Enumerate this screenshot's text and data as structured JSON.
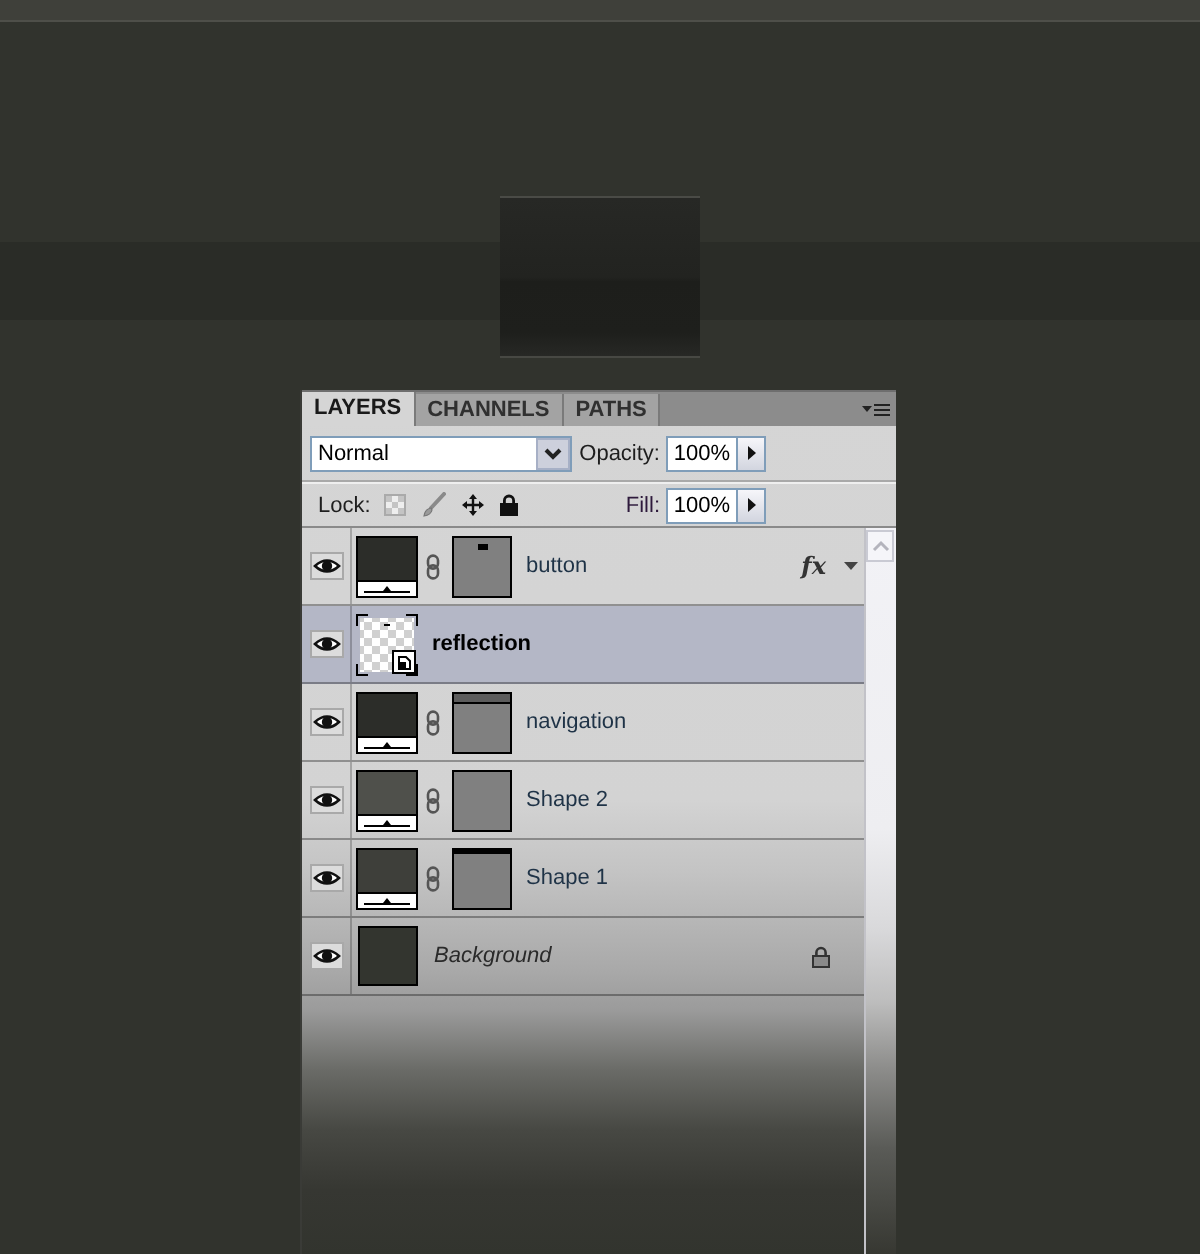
{
  "panel": {
    "tabs": [
      {
        "label": "LAYERS",
        "selected": true
      },
      {
        "label": "CHANNELS",
        "selected": false
      },
      {
        "label": "PATHS",
        "selected": false
      }
    ],
    "blend_mode": {
      "value": "Normal"
    },
    "opacity": {
      "label": "Opacity:",
      "value": "100%"
    },
    "lock": {
      "label": "Lock:"
    },
    "fill": {
      "label": "Fill:",
      "value": "100%"
    },
    "layers": [
      {
        "name": "button",
        "kind": "shape",
        "visible": true,
        "selected": false,
        "locked": false,
        "color": "#2c2d29",
        "mask": {
          "kind": "dot"
        },
        "effects": "fx"
      },
      {
        "name": "reflection",
        "kind": "smart",
        "visible": true,
        "selected": true,
        "locked": false
      },
      {
        "name": "navigation",
        "kind": "shape",
        "visible": true,
        "selected": false,
        "locked": false,
        "color": "#2c2d29",
        "mask": {
          "kind": "band"
        }
      },
      {
        "name": "Shape 2",
        "kind": "shape",
        "visible": true,
        "selected": false,
        "locked": false,
        "color": "#4f504b",
        "mask": {
          "kind": "plain"
        }
      },
      {
        "name": "Shape 1",
        "kind": "shape",
        "visible": true,
        "selected": false,
        "locked": false,
        "color": "#3e3f3a",
        "mask": {
          "kind": "edge"
        }
      },
      {
        "name": "Background",
        "kind": "background",
        "visible": true,
        "selected": false,
        "locked": true,
        "color": "#33352f"
      }
    ]
  }
}
